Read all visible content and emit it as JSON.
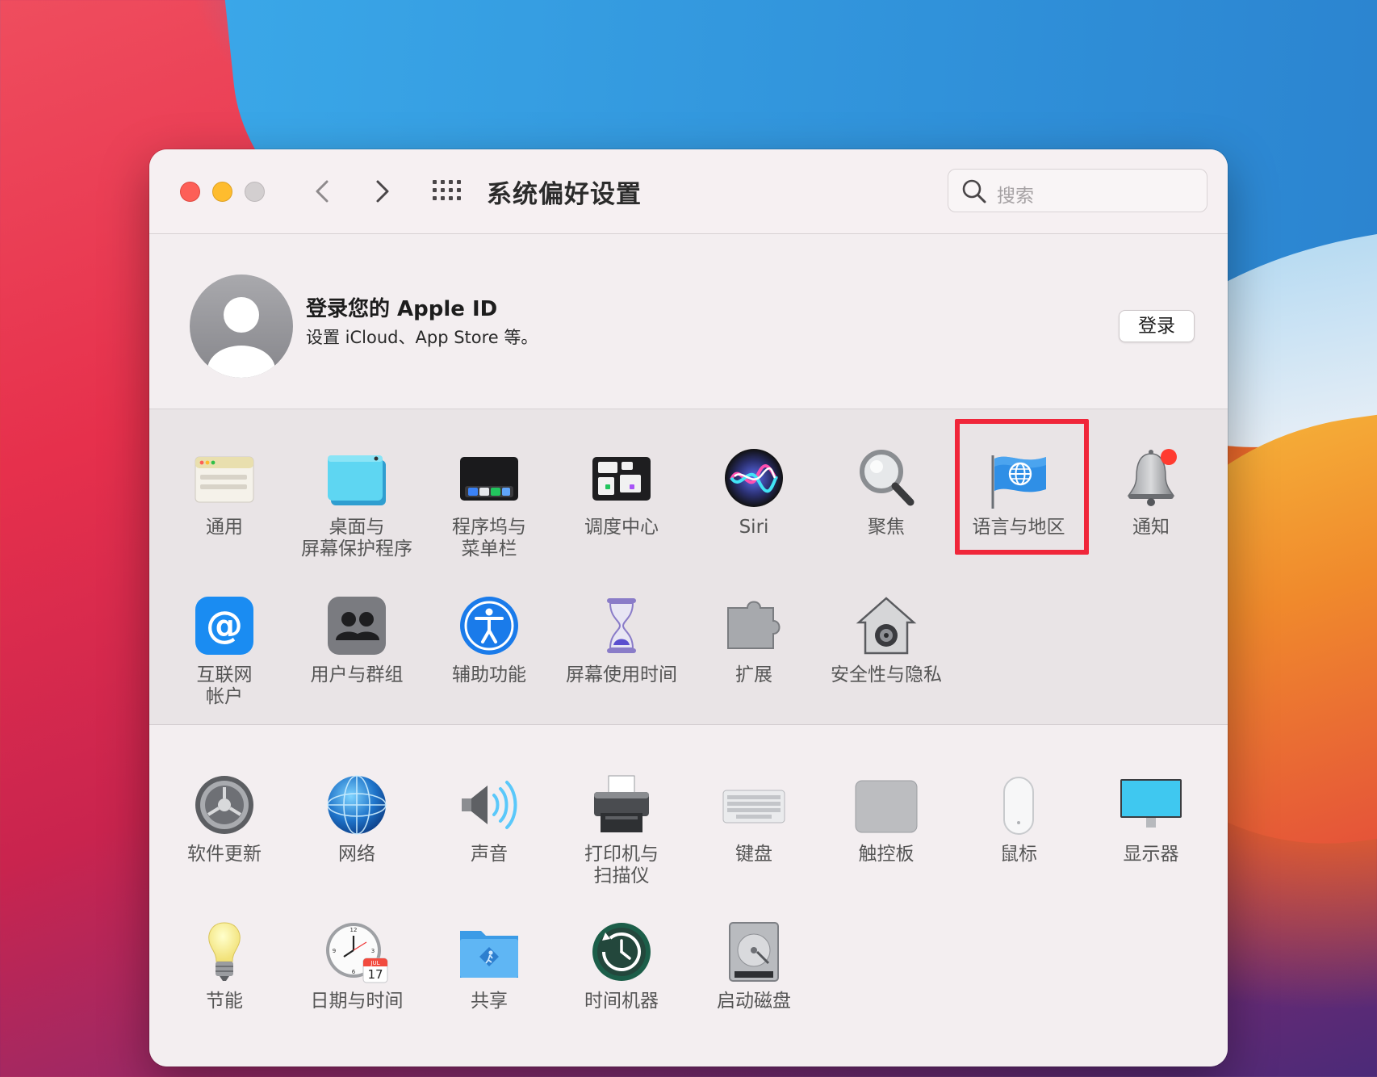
{
  "window": {
    "title": "系统偏好设置"
  },
  "search": {
    "placeholder": "搜索"
  },
  "account": {
    "title": "登录您的 Apple ID",
    "subtitle": "设置 iCloud、App Store 等。",
    "login_label": "登录"
  },
  "row1": [
    {
      "label": "通用",
      "icon": "general-icon"
    },
    {
      "label": "桌面与\n屏幕保护程序",
      "icon": "desktop-screensaver-icon"
    },
    {
      "label": "程序坞与\n菜单栏",
      "icon": "dock-menubar-icon"
    },
    {
      "label": "调度中心",
      "icon": "mission-control-icon"
    },
    {
      "label": "Siri",
      "icon": "siri-icon"
    },
    {
      "label": "聚焦",
      "icon": "spotlight-icon"
    },
    {
      "label": "语言与地区",
      "icon": "language-region-icon"
    },
    {
      "label": "通知",
      "icon": "notifications-icon"
    }
  ],
  "row2": [
    {
      "label": "互联网\n帐户",
      "icon": "internet-accounts-icon"
    },
    {
      "label": "用户与群组",
      "icon": "users-groups-icon"
    },
    {
      "label": "辅助功能",
      "icon": "accessibility-icon"
    },
    {
      "label": "屏幕使用时间",
      "icon": "screen-time-icon"
    },
    {
      "label": "扩展",
      "icon": "extensions-icon"
    },
    {
      "label": "安全性与隐私",
      "icon": "security-privacy-icon"
    }
  ],
  "row3": [
    {
      "label": "软件更新",
      "icon": "software-update-icon"
    },
    {
      "label": "网络",
      "icon": "network-icon"
    },
    {
      "label": "声音",
      "icon": "sound-icon"
    },
    {
      "label": "打印机与\n扫描仪",
      "icon": "printer-scanner-icon"
    },
    {
      "label": "键盘",
      "icon": "keyboard-icon"
    },
    {
      "label": "触控板",
      "icon": "trackpad-icon"
    },
    {
      "label": "鼠标",
      "icon": "mouse-icon"
    },
    {
      "label": "显示器",
      "icon": "displays-icon"
    }
  ],
  "row4": [
    {
      "label": "节能",
      "icon": "energy-saver-icon"
    },
    {
      "label": "日期与时间",
      "icon": "date-time-icon"
    },
    {
      "label": "共享",
      "icon": "sharing-icon"
    },
    {
      "label": "时间机器",
      "icon": "time-machine-icon"
    },
    {
      "label": "启动磁盘",
      "icon": "startup-disk-icon"
    }
  ],
  "calendar_icon": {
    "month": "JUL",
    "day": "17"
  },
  "colors": {
    "highlight": "#f0263a",
    "accent_blue": "#2f8fd8"
  }
}
